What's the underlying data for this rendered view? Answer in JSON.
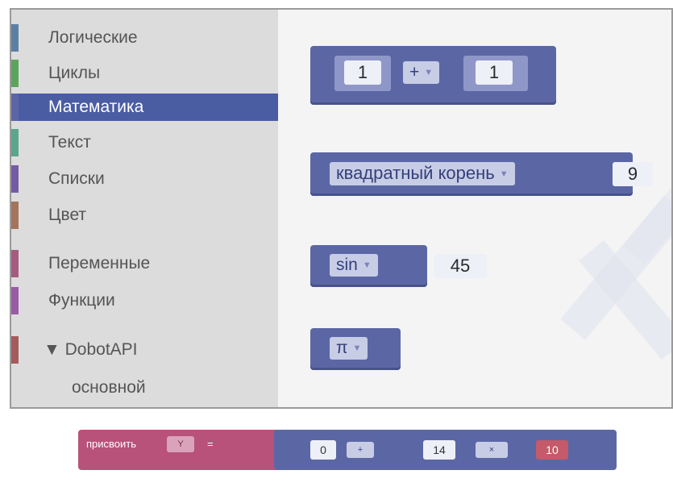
{
  "toolbox": {
    "categories": [
      {
        "label": "Логические",
        "color": "#5b80a5"
      },
      {
        "label": "Циклы",
        "color": "#5ba55b"
      },
      {
        "label": "Математика",
        "color": "#5b67a5"
      },
      {
        "label": "Текст",
        "color": "#5ba58c"
      },
      {
        "label": "Списки",
        "color": "#745ba5"
      },
      {
        "label": "Цвет",
        "color": "#a5745b"
      },
      {
        "label": "Переменные",
        "color": "#a55b80"
      },
      {
        "label": "Функции",
        "color": "#995ba5"
      },
      {
        "label": "▼ DobotAPI",
        "color": "#a55b5b"
      },
      {
        "label": "основной",
        "color": ""
      }
    ],
    "selected_index": 2
  },
  "workspace": {
    "add_block": {
      "left": "1",
      "op": "+",
      "right": "1"
    },
    "sqrt_block": {
      "func": "квадратный корень",
      "value": "9"
    },
    "sin_block": {
      "func": "sin",
      "value": "45"
    },
    "pi_block": {
      "const": "π"
    }
  },
  "bottom": {
    "assign_label": "присвоить",
    "var_name": "Y",
    "equals": "=",
    "left_num": "0",
    "inner_num": "14",
    "op1": "+",
    "op2": "×",
    "last": "10"
  },
  "colors": {
    "math": "#5b67a5",
    "variables": "#b8527a",
    "selected": "#4a5da3"
  }
}
